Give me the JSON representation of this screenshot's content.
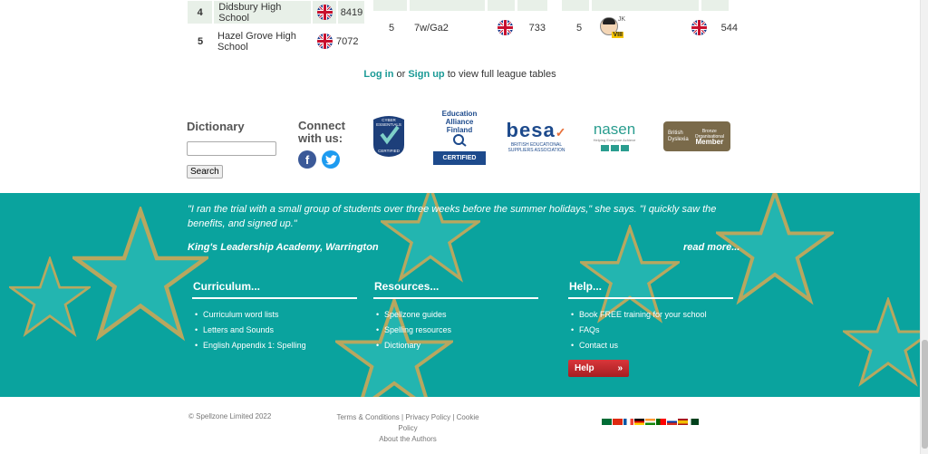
{
  "league_a": {
    "rows": [
      {
        "rank": "4",
        "school": "Didsbury High School",
        "score": "8419"
      },
      {
        "rank": "5",
        "school": "Hazel Grove High School",
        "score": "7072"
      }
    ]
  },
  "league_b": {
    "row": {
      "rank": "5",
      "name": "7w/Ga2",
      "score": "733"
    }
  },
  "league_c": {
    "row": {
      "rank": "5",
      "initials": "JK",
      "badge": "VIII",
      "score": "544"
    }
  },
  "login_line": {
    "login": "Log in",
    "or": " or ",
    "signup": "Sign up",
    "suffix": " to view full league tables"
  },
  "dictionary": {
    "title": "Dictionary",
    "search_value": "",
    "button": "Search"
  },
  "connect": {
    "title_1": "Connect",
    "title_2": "with us:"
  },
  "logos": {
    "cyber_1": "CYBER",
    "cyber_2": "ESSENTIALS",
    "cyber_3": "CERTIFIED",
    "eaf_1": "Education",
    "eaf_2": "Alliance",
    "eaf_3": "Finland",
    "eaf_cert": "CERTIFIED",
    "besa_word": "besa",
    "besa_sub": "BRITISH EDUCATIONAL SUPPLIERS ASSOCIATION",
    "nasen_word": "nasen",
    "nasen_sub": "Helping Everyone Achieve",
    "bda_left_1": "British",
    "bda_left_2": "Dyslexia",
    "bda_right_1": "Bronze Organisational",
    "bda_right_2": "Member"
  },
  "testimonial": {
    "quote": "\"I ran the trial with a small group of students over three weeks before the summer holidays,\" she says. \"I quickly saw the benefits, and signed up.\"",
    "source": "King's Leadership Academy, Warrington",
    "read_more": "read more..."
  },
  "footer_cols": [
    {
      "title": "Curriculum...",
      "items": [
        "Curriculum word lists",
        "Letters and Sounds",
        "English Appendix 1: Spelling"
      ]
    },
    {
      "title": "Resources...",
      "items": [
        "Spellzone guides",
        "Spelling resources",
        "Dictionary"
      ]
    },
    {
      "title": "Help...",
      "items": [
        "Book FREE training for your school",
        "FAQs",
        "Contact us"
      ]
    }
  ],
  "help_button": {
    "label": "Help",
    "arrow": "»"
  },
  "bottom": {
    "copyright": "© Spellzone Limited 2022",
    "terms": "Terms & Conditions",
    "privacy": "Privacy Policy",
    "cookie": "Cookie Policy",
    "sep": " | ",
    "about": "About the Authors"
  },
  "colors": {
    "teal": "#0aa39e",
    "link": "#1a9a96",
    "help_red": "#c4282c"
  },
  "icons": [
    "uk-flag-icon",
    "facebook-icon",
    "twitter-icon"
  ]
}
